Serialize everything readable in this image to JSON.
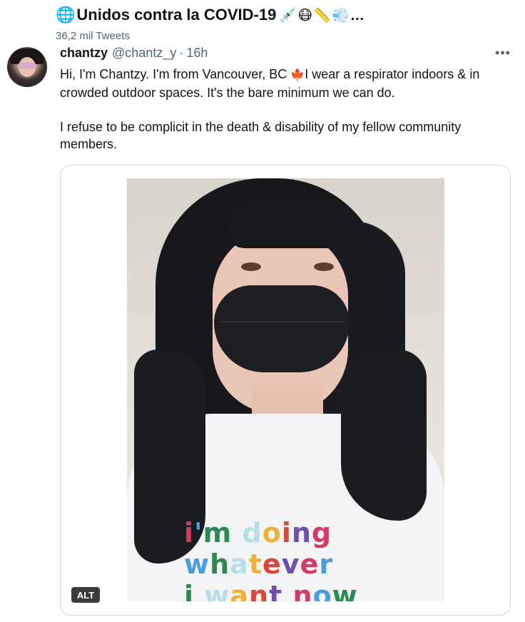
{
  "header": {
    "title": "Unidos contra la COVID-19",
    "title_icon": "globe-icon",
    "title_emoji_tail": "💉😷📏💨…",
    "tweet_count": "36,2 mil Tweets"
  },
  "tweet": {
    "author_name": "chantzy",
    "author_handle": "@chantz_y",
    "separator": "·",
    "timestamp": "16h",
    "more_icon": "more-icon",
    "text_line1_a": "Hi, I'm Chantzy. I'm from Vancouver, BC ",
    "flag": "🍁",
    "text_line1_b": "I wear a respirator indoors & in crowded outdoor spaces. It's the bare minimum we can do.",
    "text_para2": "I refuse to be complicit in the death & disability of my fellow community members.",
    "media": {
      "alt_label": "ALT",
      "shirt_line1": "i'm doing",
      "shirt_line2": "whatever",
      "shirt_line3": "i want now"
    }
  },
  "colors": {
    "text_primary": "#0f1419",
    "text_secondary": "#536471",
    "border": "#cfd9de",
    "flag_red": "#d81e2c"
  }
}
